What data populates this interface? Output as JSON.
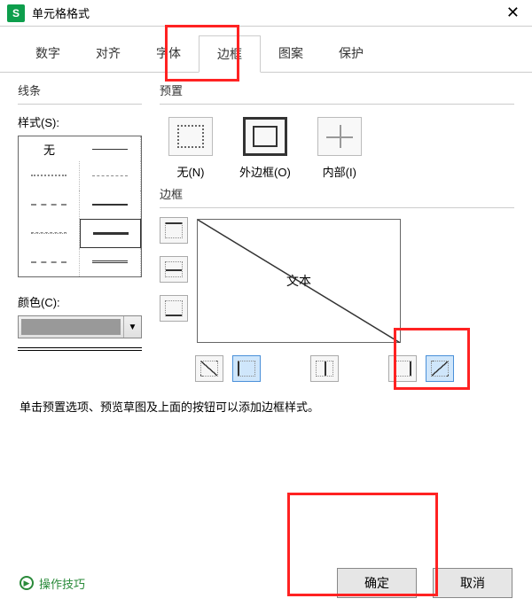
{
  "titlebar": {
    "icon_letter": "S",
    "title": "单元格格式"
  },
  "tabs": [
    "数字",
    "对齐",
    "字体",
    "边框",
    "图案",
    "保护"
  ],
  "active_tab_index": 3,
  "left": {
    "line_section": "线条",
    "style_label": "样式(S):",
    "style_none": "无",
    "color_label": "颜色(C):"
  },
  "right": {
    "preset_section": "预置",
    "presets": [
      {
        "label": "无(N)"
      },
      {
        "label": "外边框(O)"
      },
      {
        "label": "内部(I)"
      }
    ],
    "border_section": "边框",
    "preview_text": "文本"
  },
  "hint": "单击预置选项、预览草图及上面的按钮可以添加边框样式。",
  "footer": {
    "tips": "操作技巧",
    "ok": "确定",
    "cancel": "取消"
  }
}
